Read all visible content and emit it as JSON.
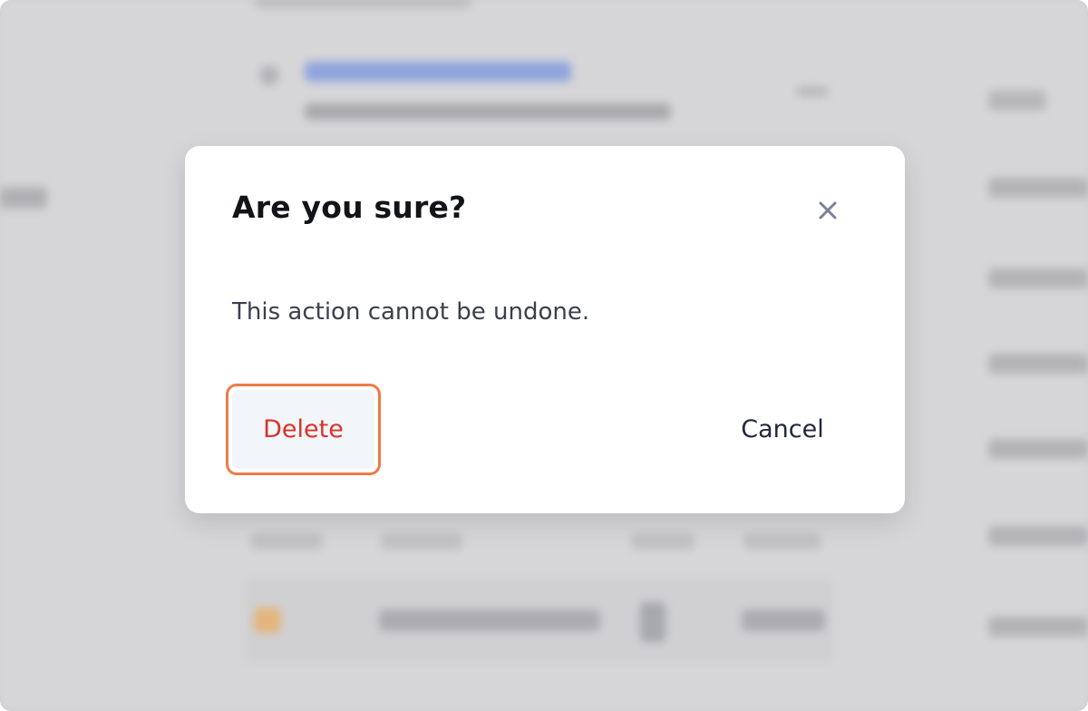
{
  "dialog": {
    "title": "Are you sure?",
    "message": "This action cannot be undone.",
    "close_icon": "close-icon",
    "delete_label": "Delete",
    "cancel_label": "Cancel"
  },
  "colors": {
    "delete_text": "#d7342b",
    "highlight_border": "#ef7a45",
    "cancel_text": "#23283b",
    "title_text": "#111418",
    "overlay": "#cfcfd1"
  }
}
